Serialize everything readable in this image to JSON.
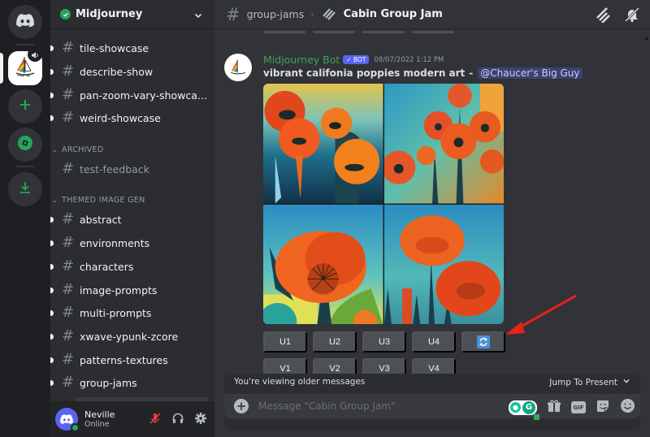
{
  "server": {
    "name": "Midjourney",
    "verified": true
  },
  "channels_top": [
    {
      "name": "tile-showcase",
      "unread": true
    },
    {
      "name": "describe-show",
      "unread": true
    },
    {
      "name": "pan-zoom-vary-showca...",
      "unread": true
    },
    {
      "name": "weird-showcase",
      "unread": true
    }
  ],
  "archived": {
    "label": "ARCHIVED",
    "channels": [
      {
        "name": "test-feedback",
        "unread": false
      }
    ]
  },
  "themed": {
    "label": "THEMED IMAGE GEN",
    "channels": [
      {
        "name": "abstract",
        "unread": true
      },
      {
        "name": "environments",
        "unread": true
      },
      {
        "name": "characters",
        "unread": true
      },
      {
        "name": "image-prompts",
        "unread": true
      },
      {
        "name": "multi-prompts",
        "unread": true
      },
      {
        "name": "xwave-ypunk-zcore",
        "unread": true
      },
      {
        "name": "patterns-textures",
        "unread": true
      },
      {
        "name": "group-jams",
        "unread": true
      }
    ]
  },
  "user": {
    "name": "Neville",
    "status": "Online"
  },
  "header": {
    "channel": "group-jams",
    "thread": "Cabin Group Jam"
  },
  "message": {
    "author": "Midjourney Bot",
    "bot_tag": "BOT",
    "timestamp": "08/07/2022 1:12 PM",
    "prompt": "vibrant califonia poppies modern art",
    "separator": "-",
    "mention": "@Chaucer's Big Guy",
    "image_alt": "4 generated images of vibrant poppies"
  },
  "buttons": {
    "upscale": [
      "U1",
      "U2",
      "U3",
      "U4"
    ],
    "variation": [
      "V1",
      "V2",
      "V3",
      "V4"
    ],
    "reroll_icon": "refresh-icon"
  },
  "annotation": {
    "arrow_color": "#e8221a"
  },
  "older_bar": {
    "text": "You're viewing older messages",
    "jump_label": "Jump To Present"
  },
  "composer": {
    "placeholder": "Message \"Cabin Group Jam\"",
    "value": "",
    "gif_label": "GIF",
    "grammarly_letter": "G"
  },
  "colors": {
    "accent": "#5865f2",
    "online": "#23a55a",
    "bot_name": "#3ba55c",
    "mute_red": "#f23f43"
  }
}
